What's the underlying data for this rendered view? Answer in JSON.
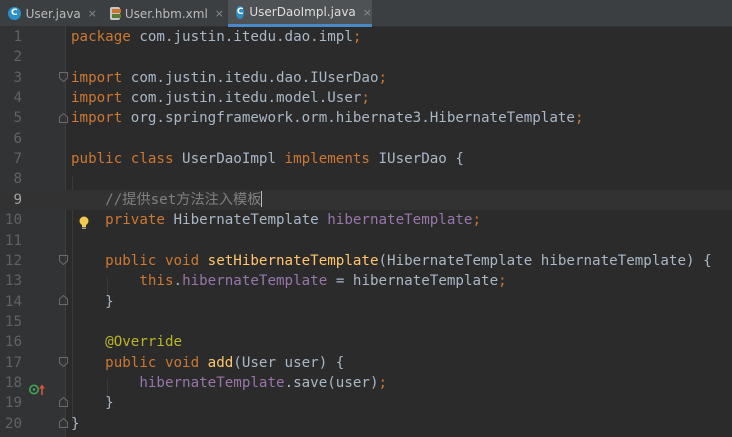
{
  "tabs": [
    {
      "label": "User.java",
      "icon": "java-class-icon",
      "active": false
    },
    {
      "label": "User.hbm.xml",
      "icon": "xml-file-icon",
      "active": false
    },
    {
      "label": "UserDaoImpl.java",
      "icon": "java-class-icon",
      "active": true
    }
  ],
  "tab_icon_letter": "C",
  "close_glyph": "×",
  "editor": {
    "current_line": 9,
    "lines": [
      {
        "n": "1",
        "tokens": [
          [
            "kw",
            "package "
          ],
          [
            "txt",
            "com.justin.itedu.dao.impl"
          ],
          [
            "kw",
            ";"
          ]
        ]
      },
      {
        "n": "2",
        "tokens": []
      },
      {
        "n": "3",
        "tokens": [
          [
            "kw",
            "import "
          ],
          [
            "txt",
            "com.justin.itedu.dao.IUserDao"
          ],
          [
            "kw",
            ";"
          ]
        ]
      },
      {
        "n": "4",
        "tokens": [
          [
            "kw",
            "import "
          ],
          [
            "txt",
            "com.justin.itedu.model.User"
          ],
          [
            "kw",
            ";"
          ]
        ]
      },
      {
        "n": "5",
        "tokens": [
          [
            "kw",
            "import "
          ],
          [
            "txt",
            "org.springframework.orm.hibernate3.HibernateTemplate"
          ],
          [
            "kw",
            ";"
          ]
        ]
      },
      {
        "n": "6",
        "tokens": []
      },
      {
        "n": "7",
        "tokens": [
          [
            "kw",
            "public class "
          ],
          [
            "txt",
            "UserDaoImpl "
          ],
          [
            "kw",
            "implements "
          ],
          [
            "txt",
            "IUserDao {"
          ]
        ]
      },
      {
        "n": "8",
        "tokens": []
      },
      {
        "n": "9",
        "tokens": [
          [
            "txt",
            "    "
          ],
          [
            "cm",
            "//提供set方法注入模板"
          ]
        ]
      },
      {
        "n": "10",
        "tokens": [
          [
            "txt",
            "    "
          ],
          [
            "kw",
            "private "
          ],
          [
            "txt",
            "HibernateTemplate "
          ],
          [
            "fld",
            "hibernateTemplate"
          ],
          [
            "kw",
            ";"
          ]
        ]
      },
      {
        "n": "11",
        "tokens": []
      },
      {
        "n": "12",
        "tokens": [
          [
            "txt",
            "    "
          ],
          [
            "kw",
            "public void "
          ],
          [
            "fn",
            "setHibernateTemplate"
          ],
          [
            "txt",
            "(HibernateTemplate hibernateTemplate) {"
          ]
        ]
      },
      {
        "n": "13",
        "tokens": [
          [
            "txt",
            "        "
          ],
          [
            "kw",
            "this"
          ],
          [
            "txt",
            "."
          ],
          [
            "fld",
            "hibernateTemplate"
          ],
          [
            "txt",
            " = hibernateTemplate"
          ],
          [
            "kw",
            ";"
          ]
        ]
      },
      {
        "n": "14",
        "tokens": [
          [
            "txt",
            "    }"
          ]
        ]
      },
      {
        "n": "15",
        "tokens": []
      },
      {
        "n": "16",
        "tokens": [
          [
            "txt",
            "    "
          ],
          [
            "an",
            "@Override"
          ]
        ]
      },
      {
        "n": "17",
        "tokens": [
          [
            "txt",
            "    "
          ],
          [
            "kw",
            "public void "
          ],
          [
            "fn",
            "add"
          ],
          [
            "txt",
            "(User user) {"
          ]
        ]
      },
      {
        "n": "18",
        "tokens": [
          [
            "txt",
            "        "
          ],
          [
            "fld",
            "hibernateTemplate"
          ],
          [
            "txt",
            ".save(user)"
          ],
          [
            "kw",
            ";"
          ]
        ]
      },
      {
        "n": "19",
        "tokens": [
          [
            "txt",
            "    }"
          ]
        ]
      },
      {
        "n": "20",
        "tokens": [
          [
            "txt",
            "}"
          ]
        ]
      }
    ]
  },
  "colors": {
    "keyword": "#cc7832",
    "comment": "#808080",
    "field": "#9876aa",
    "method": "#ffc66d",
    "annotation": "#bbb529",
    "text": "#a9b7c6",
    "tab_accent": "#4a88c7"
  },
  "gutter_icons": {
    "intention": "lightbulb-icon",
    "override": "override-marker-icon",
    "fold_open": "fold-open-icon",
    "fold_close": "fold-close-icon"
  }
}
